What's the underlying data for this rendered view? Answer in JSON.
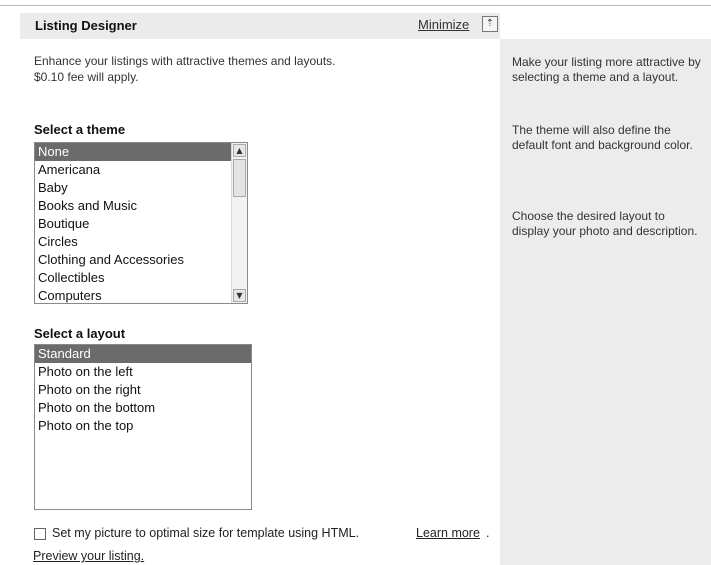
{
  "header": {
    "title": "Listing Designer",
    "minimize_label": "Minimize",
    "minimize_icon": "collapse-icon"
  },
  "intro": {
    "line1": "Enhance your listings with attractive themes and layouts.",
    "line2": "$0.10 fee will apply."
  },
  "theme": {
    "label": "Select a theme",
    "items": [
      "None",
      "Americana",
      "Baby",
      "Books and Music",
      "Boutique",
      "Circles",
      "Clothing and Accessories",
      "Collectibles",
      "Computers"
    ],
    "selected": "None"
  },
  "layout": {
    "label": "Select a layout",
    "items": [
      "Standard",
      "Photo on the left",
      "Photo on the right",
      "Photo on the bottom",
      "Photo on the top"
    ],
    "selected": "Standard"
  },
  "options": {
    "optimal_size_label": "Set my picture to optimal size for template using HTML.",
    "optimal_size_checked": false,
    "learn_more": "Learn more",
    "learn_more_suffix": ".",
    "preview": "Preview your listing."
  },
  "sidebar": {
    "help1": "Make your listing more attractive by selecting a theme and a layout.",
    "help2": "The theme will also define the default font and background color.",
    "help3": "Choose the desired layout to display your photo and description."
  },
  "colors": {
    "selected_item_bg": "#6b6b6b",
    "header_bg": "#ebebeb",
    "sidebar_bg": "#ececec"
  }
}
